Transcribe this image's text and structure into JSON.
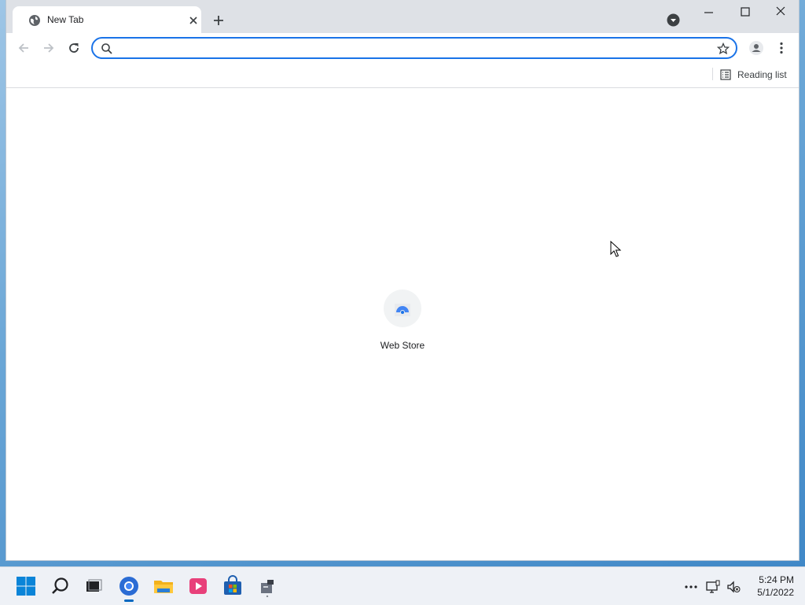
{
  "browser": {
    "tab": {
      "title": "New Tab"
    },
    "omnibox": {
      "value": "",
      "placeholder": ""
    },
    "bookmarks_bar": {
      "reading_list_label": "Reading list"
    }
  },
  "new_tab_page": {
    "shortcuts": [
      {
        "label": "Web Store",
        "icon": "web-store-icon"
      }
    ]
  },
  "taskbar": {
    "apps": [
      "start-icon",
      "search-icon",
      "task-view-icon",
      "chrome-icon",
      "file-explorer-icon",
      "media-player-icon",
      "microsoft-store-icon",
      "app-icon"
    ],
    "clock": {
      "time": "5:24 PM",
      "date": "5/1/2022"
    }
  },
  "colors": {
    "accent": "#1a73e8",
    "titlebar": "#dee1e6",
    "taskbar_accent": "#0067c0"
  }
}
